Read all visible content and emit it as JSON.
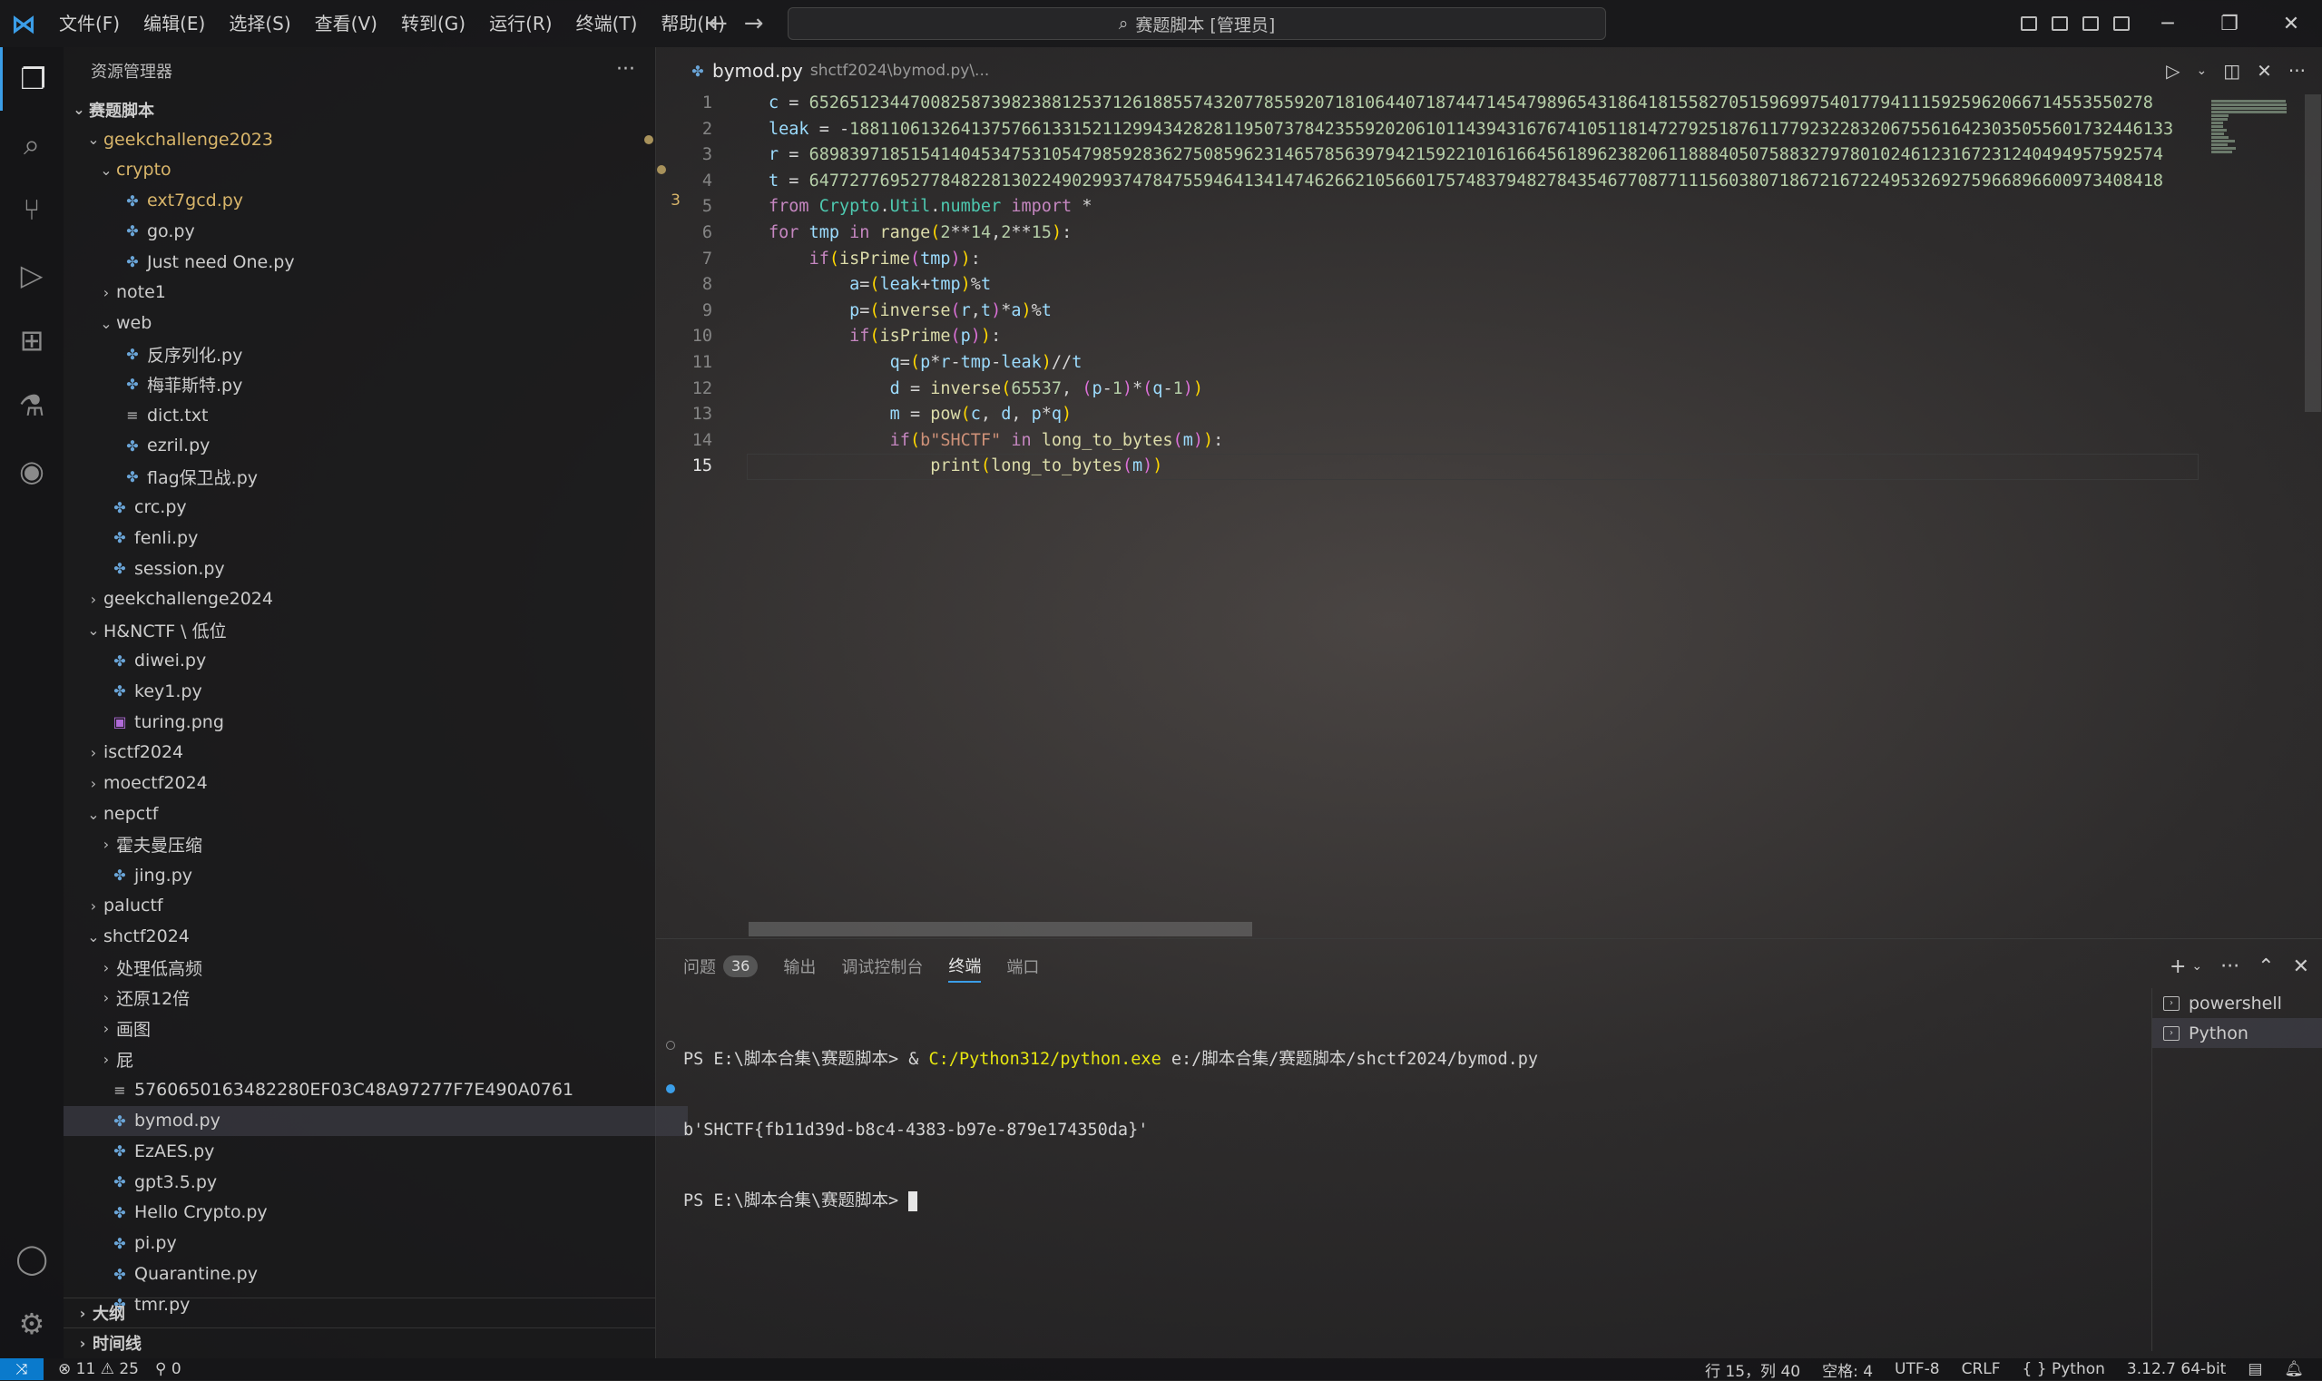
{
  "titlebar": {
    "menu": [
      "文件(F)",
      "编辑(E)",
      "选择(S)",
      "查看(V)",
      "转到(G)",
      "运行(R)",
      "终端(T)",
      "帮助(H)"
    ],
    "search_text": "赛题脚本 [管理员]"
  },
  "sidebar": {
    "header": "资源管理器",
    "root": "赛题脚本",
    "tree": [
      {
        "label": "geekchallenge2023",
        "type": "folder-open"
      },
      {
        "label": "crypto",
        "type": "folder-open"
      },
      {
        "label": "ext7gcd.py",
        "type": "file",
        "problems": "3"
      },
      {
        "label": "go.py",
        "type": "file"
      },
      {
        "label": "Just need One.py",
        "type": "file"
      },
      {
        "label": "note1",
        "type": "folder"
      },
      {
        "label": "web",
        "type": "folder-open"
      },
      {
        "label": "反序列化.py",
        "type": "file"
      },
      {
        "label": "梅菲斯特.py",
        "type": "file"
      },
      {
        "label": "dict.txt",
        "type": "text"
      },
      {
        "label": "ezril.py",
        "type": "file"
      },
      {
        "label": "flag保卫战.py",
        "type": "file"
      },
      {
        "label": "crc.py",
        "type": "file"
      },
      {
        "label": "fenli.py",
        "type": "file"
      },
      {
        "label": "session.py",
        "type": "file"
      },
      {
        "label": "geekchallenge2024",
        "type": "folder"
      },
      {
        "label": "H&NCTF \\ 低位",
        "type": "folder-open"
      },
      {
        "label": "diwei.py",
        "type": "file"
      },
      {
        "label": "key1.py",
        "type": "file"
      },
      {
        "label": "turing.png",
        "type": "image"
      },
      {
        "label": "isctf2024",
        "type": "folder"
      },
      {
        "label": "moectf2024",
        "type": "folder"
      },
      {
        "label": "nepctf",
        "type": "folder-open"
      },
      {
        "label": "霍夫曼压缩",
        "type": "folder"
      },
      {
        "label": "jing.py",
        "type": "file"
      },
      {
        "label": "paluctf",
        "type": "folder"
      },
      {
        "label": "shctf2024",
        "type": "folder-open"
      },
      {
        "label": "处理低高频",
        "type": "folder"
      },
      {
        "label": "还原12倍",
        "type": "folder"
      },
      {
        "label": "画图",
        "type": "folder"
      },
      {
        "label": "屁",
        "type": "folder"
      },
      {
        "label": "5760650163482280EF03C48A97277F7E490A0761",
        "type": "text"
      },
      {
        "label": "bymod.py",
        "type": "file"
      },
      {
        "label": "EzAES.py",
        "type": "file"
      },
      {
        "label": "gpt3.5.py",
        "type": "file"
      },
      {
        "label": "Hello Crypto.py",
        "type": "file"
      },
      {
        "label": "pi.py",
        "type": "file"
      },
      {
        "label": "Quarantine.py",
        "type": "file"
      },
      {
        "label": "tmr.py",
        "type": "file"
      }
    ],
    "outline": "大纲",
    "timeline": "时间线"
  },
  "editor": {
    "tab_name": "bymod.py",
    "tab_path": "shctf2024\\bymod.py\\...",
    "lines": [
      "c = 6526512344700825873982388125371261885574320778559207181064407187447145479896543186418155827051596997540177941115925962066714553550278",
      "leak = -18811061326413757661331521129943428281195073784235592020610114394316767410511814727925187611779232283206755616423035055601732446133",
      "r = 68983971851541404534753105479859283627508596231465785639794215922101616645618962382061188840507588327978010246123167231240494957592574",
      "t = 64772776952778482281302249029937478475594641341474626621056601757483794827843546770877111560380718672167224953269275966896600973408418",
      "from Crypto.Util.number import *",
      "for tmp in range(2**14,2**15):",
      "    if(isPrime(tmp)):",
      "        a=(leak+tmp)%t",
      "        p=(inverse(r,t)*a)%t",
      "        if(isPrime(p)):",
      "            q=(p*r-tmp-leak)//t",
      "            d = inverse(65537, (p-1)*(q-1))",
      "            m = pow(c, d, p*q)",
      "            if(b\"SHCTF\" in long_to_bytes(m)):",
      "                print(long_to_bytes(m))"
    ],
    "current_line": 15
  },
  "panel": {
    "tabs": [
      "问题",
      "输出",
      "调试控制台",
      "终端",
      "端口"
    ],
    "problems_count": "36",
    "active_tab": "终端",
    "terminal": {
      "line1_prompt": "PS E:\\脚本合集\\赛题脚本> & ",
      "line1_exe": "C:/Python312/python.exe",
      "line1_arg": " e:/脚本合集/赛题脚本/shctf2024/bymod.py",
      "line2": "b'SHCTF{fb11d39d-b8c4-4383-b97e-879e174350da}'",
      "line3_prompt": "PS E:\\脚本合集\\赛题脚本> "
    },
    "terminals": [
      "powershell",
      "Python"
    ]
  },
  "statusbar": {
    "errors": "11",
    "warnings": "25",
    "ports": "0",
    "position": "行 15，列 40",
    "spaces": "空格: 4",
    "encoding": "UTF-8",
    "eol": "CRLF",
    "language": "Python",
    "interpreter": "3.12.7 64-bit"
  },
  "colors": {
    "accent": "#3b9ee8",
    "modified": "#d8b56a"
  }
}
